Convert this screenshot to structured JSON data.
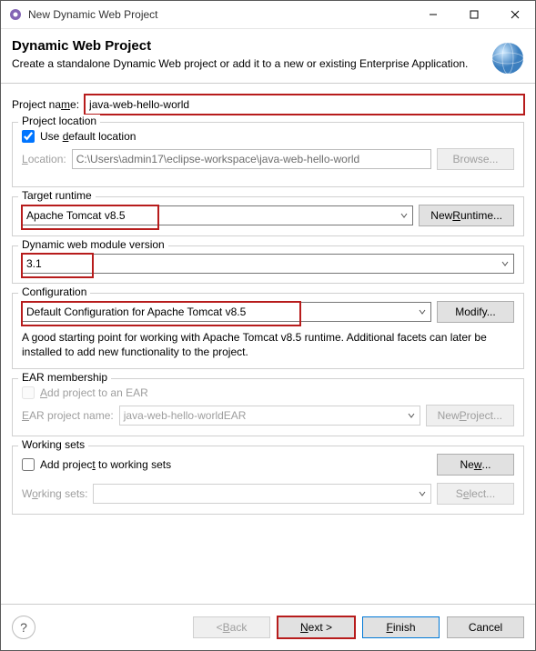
{
  "window": {
    "title": "New Dynamic Web Project"
  },
  "banner": {
    "heading": "Dynamic Web Project",
    "subtext": "Create a standalone Dynamic Web project or add it to a new or existing Enterprise Application."
  },
  "project_name": {
    "label": "Project name:",
    "value": "java-web-hello-world"
  },
  "location": {
    "group_label": "Project location",
    "use_default_label": "Use default location",
    "use_default_checked": true,
    "location_label": "Location:",
    "location_value": "C:\\Users\\admin17\\eclipse-workspace\\java-web-hello-world",
    "browse_label": "Browse..."
  },
  "runtime": {
    "group_label": "Target runtime",
    "value": "Apache Tomcat v8.5",
    "new_runtime_label": "New Runtime..."
  },
  "module_version": {
    "group_label": "Dynamic web module version",
    "value": "3.1"
  },
  "config": {
    "group_label": "Configuration",
    "value": "Default Configuration for Apache Tomcat v8.5",
    "modify_label": "Modify...",
    "description": "A good starting point for working with Apache Tomcat v8.5 runtime. Additional facets can later be installed to add new functionality to the project."
  },
  "ear": {
    "group_label": "EAR membership",
    "add_label": "Add project to an EAR",
    "add_checked": false,
    "ear_name_label": "EAR project name:",
    "ear_name_value": "java-web-hello-worldEAR",
    "new_project_label": "New Project..."
  },
  "working_sets": {
    "group_label": "Working sets",
    "add_label": "Add project to working sets",
    "add_checked": false,
    "new_label": "New...",
    "ws_label": "Working sets:",
    "select_label": "Select..."
  },
  "footer": {
    "back": "< Back",
    "next": "Next >",
    "finish": "Finish",
    "cancel": "Cancel"
  }
}
